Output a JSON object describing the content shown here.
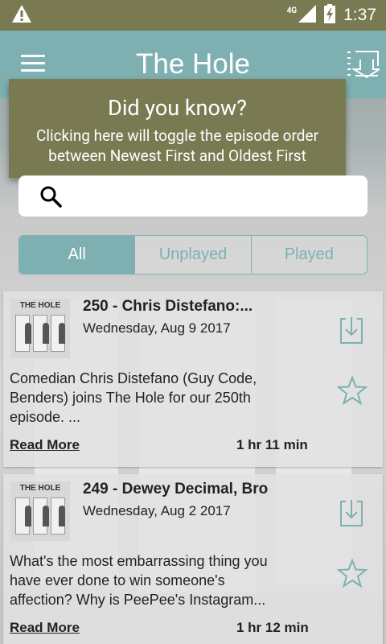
{
  "status_bar": {
    "time": "1:37",
    "network": "4G"
  },
  "app_bar": {
    "title": "The Hole"
  },
  "tooltip": {
    "title": "Did you know?",
    "body_line1": "Clicking here will toggle the episode order",
    "body_line2": "between Newest First and Oldest First"
  },
  "search": {
    "value": "",
    "placeholder": ""
  },
  "tabs": [
    {
      "label": "All",
      "active": true
    },
    {
      "label": "Unplayed",
      "active": false
    },
    {
      "label": "Played",
      "active": false
    }
  ],
  "episodes": [
    {
      "thumb_logo": "THE HOLE",
      "title": "250 - Chris Distefano:...",
      "date": "Wednesday, Aug 9 2017",
      "desc_line1": "Comedian Chris Distefano (Guy Code,",
      "desc_line2": "Benders) joins The Hole for our 250th",
      "desc_line3": "episode.  ...",
      "read_more": "Read More",
      "duration": "1 hr 11 min"
    },
    {
      "thumb_logo": "THE HOLE",
      "title": "249 - Dewey Decimal, Bro",
      "date": "Wednesday, Aug 2 2017",
      "desc_line1": "What's the most embarrassing thing you",
      "desc_line2": "have ever done to win someone's",
      "desc_line3": "affection? Why is PeePee's Instagram...",
      "read_more": "Read More",
      "duration": "1 hr 12 min"
    }
  ],
  "colors": {
    "status_bar": "#7a7a52",
    "app_bar": "#7fb0b1",
    "tooltip": "#7a7a52",
    "accent": "#7fb0b1"
  }
}
